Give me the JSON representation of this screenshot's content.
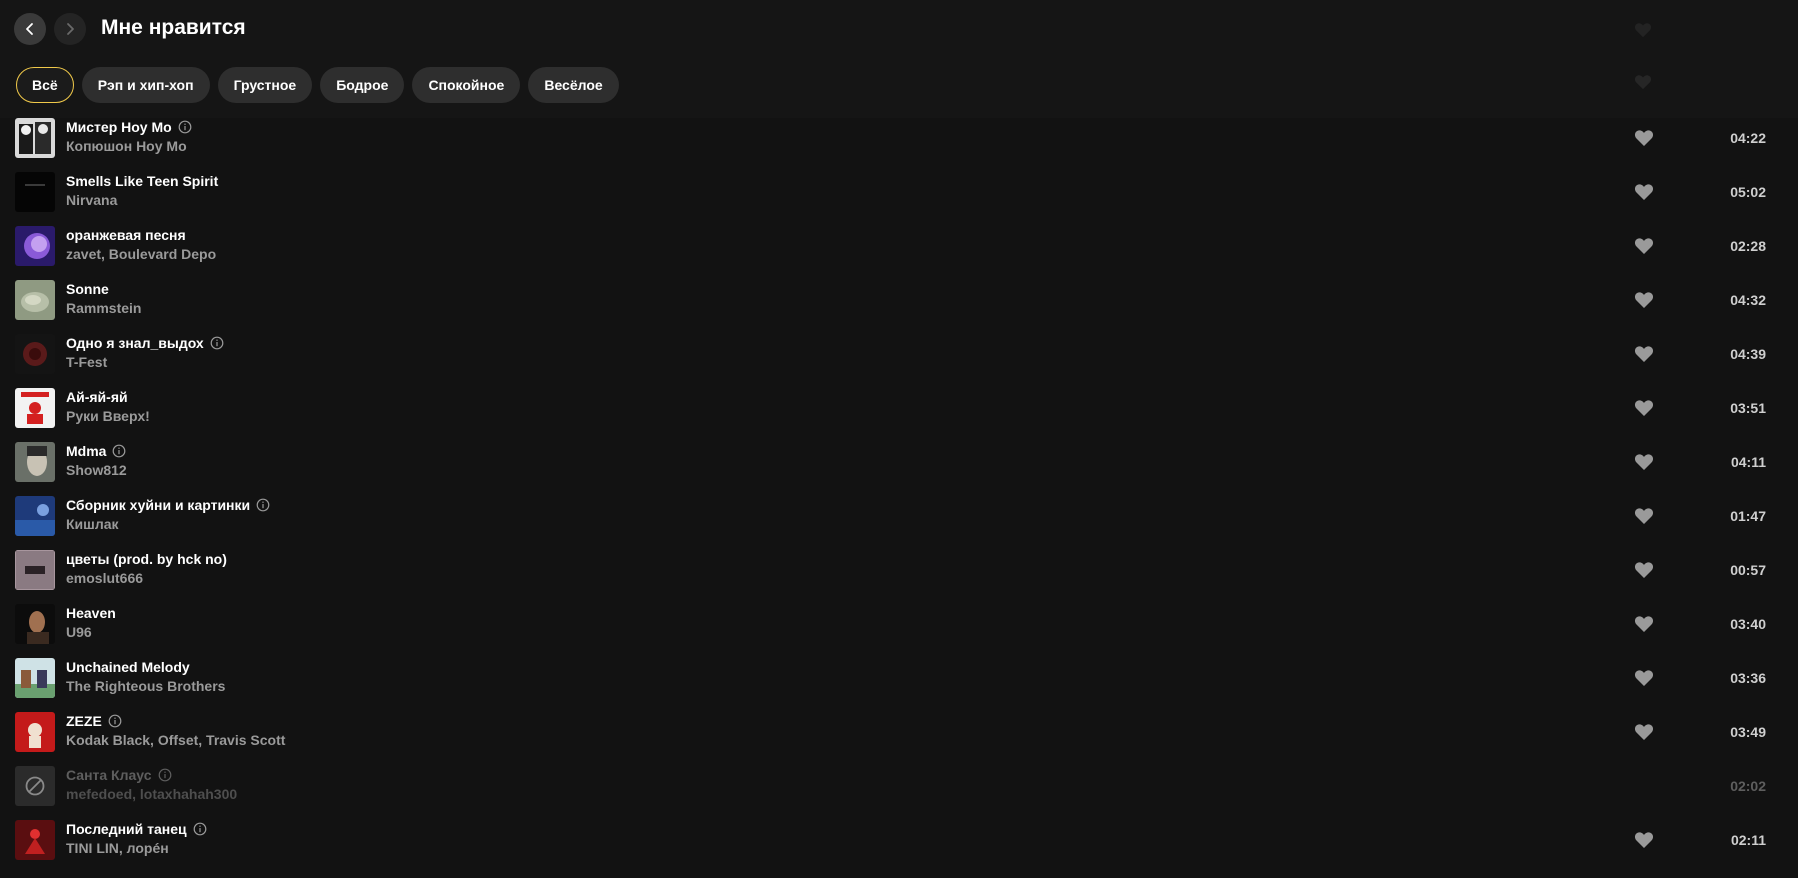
{
  "header": {
    "title": "Мне нравится",
    "back_icon": "chevron-left-icon",
    "forward_icon": "chevron-right-icon"
  },
  "filters": [
    {
      "label": "Всё",
      "active": true
    },
    {
      "label": "Рэп и хип-хоп",
      "active": false
    },
    {
      "label": "Грустное",
      "active": false
    },
    {
      "label": "Бодрое",
      "active": false
    },
    {
      "label": "Спокойное",
      "active": false
    },
    {
      "label": "Весёлое",
      "active": false
    }
  ],
  "tracks": [
    {
      "title": "Мистер Hoy Mo",
      "artist": "Копюшон Hoy Mo",
      "duration": "04:22",
      "explicit_info": true,
      "liked": true
    },
    {
      "title": "Smells Like Teen Spirit",
      "artist": "Nirvana",
      "duration": "05:02",
      "explicit_info": false,
      "liked": true
    },
    {
      "title": "оранжевая песня",
      "artist": "zavet, Boulevard Depo",
      "duration": "02:28",
      "explicit_info": false,
      "liked": true
    },
    {
      "title": "Sonne",
      "artist": "Rammstein",
      "duration": "04:32",
      "explicit_info": false,
      "liked": true
    },
    {
      "title": "Одно я знал_выдох",
      "artist": "T-Fest",
      "duration": "04:39",
      "explicit_info": true,
      "liked": true
    },
    {
      "title": "Ай-яй-яй",
      "artist": "Руки Вверх!",
      "duration": "03:51",
      "explicit_info": false,
      "liked": true
    },
    {
      "title": "Mdma",
      "artist": "Show812",
      "duration": "04:11",
      "explicit_info": true,
      "liked": true
    },
    {
      "title": "Сборник хуйни и картинки",
      "artist": "Кишлак",
      "duration": "01:47",
      "explicit_info": true,
      "liked": true
    },
    {
      "title": "цветы (prod. by hck no)",
      "artist": "emoslut666",
      "duration": "00:57",
      "explicit_info": false,
      "liked": true
    },
    {
      "title": "Heaven",
      "artist": "U96",
      "duration": "03:40",
      "explicit_info": false,
      "liked": true
    },
    {
      "title": "Unchained Melody",
      "artist": "The Righteous Brothers",
      "duration": "03:36",
      "explicit_info": false,
      "liked": true
    },
    {
      "title": "ZEZE",
      "artist": "Kodak Black, Offset, Travis Scott",
      "duration": "03:49",
      "explicit_info": true,
      "liked": true
    },
    {
      "title": "Санта Клаус",
      "artist": "mefedoed, lotaxhahah300",
      "duration": "02:02",
      "explicit_info": true,
      "liked": false,
      "unavailable": true
    },
    {
      "title": "Последний танец",
      "artist": "TINI LIN, лорéн",
      "duration": "02:11",
      "explicit_info": true,
      "liked": true
    }
  ],
  "colors": {
    "background": "#121212",
    "chip_active_border": "#f0c94a",
    "chip_bg": "#2e2e2e",
    "heart": "#9a9a9a"
  }
}
